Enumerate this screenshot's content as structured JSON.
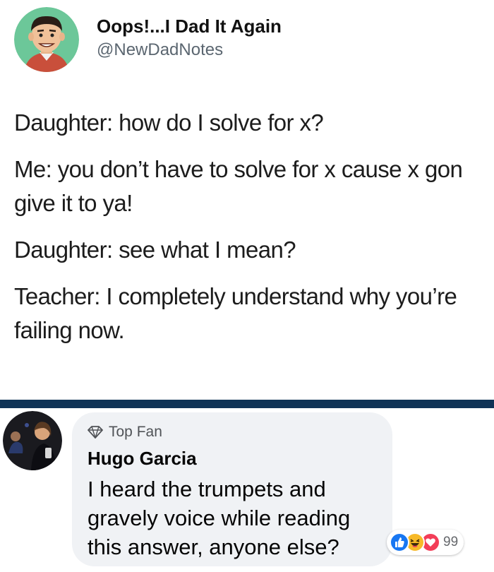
{
  "tweet": {
    "display_name": "Oops!...I Dad It Again",
    "handle": "@NewDadNotes",
    "lines": [
      "Daughter: how do I solve for x?",
      "Me: you don’t have to solve for x cause x gon give it to ya!",
      "Daughter: see what I mean?",
      "Teacher: I completely understand why you’re failing now."
    ],
    "avatar_icon": "cartoon-man-avatar-icon"
  },
  "colors": {
    "divider": "#0f3356",
    "bubble": "#f0f2f5",
    "like": "#1877f2",
    "haha": "#f7b928",
    "love": "#f33e58"
  },
  "comment": {
    "badge": "Top Fan",
    "badge_icon": "diamond-icon",
    "author": "Hugo Garcia",
    "text": "I heard the trumpets and gravely voice while reading this answer, anyone else?",
    "reactions": [
      "like-reaction-icon",
      "haha-reaction-icon",
      "love-reaction-icon"
    ],
    "reaction_count": "99"
  }
}
